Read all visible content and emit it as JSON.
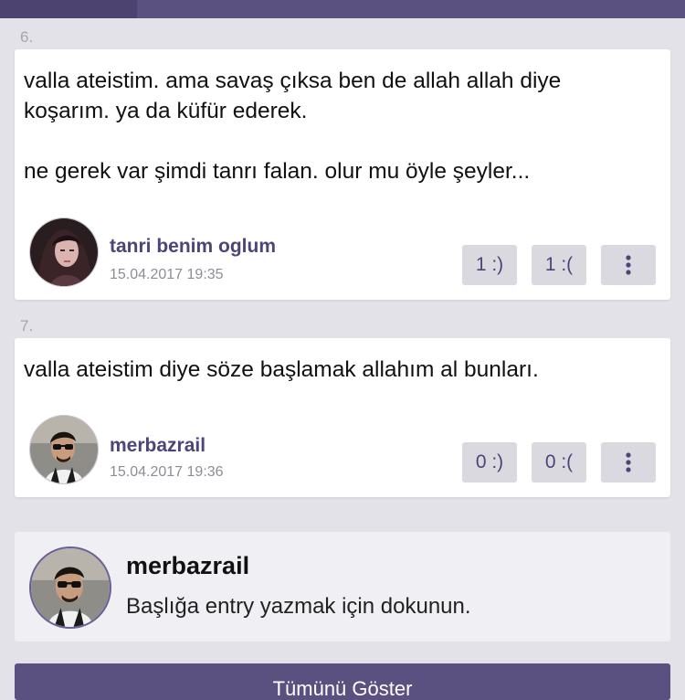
{
  "entries": [
    {
      "number": "6.",
      "text": "valla ateistim. ama savaş çıksa ben de allah allah diye koşarım. ya da küfür ederek.\n\nne gerek var şimdi tanrı falan. olur mu öyle şeyler...",
      "author": "tanri benim oglum",
      "date": "15.04.2017 19:35",
      "upvote": "1 :)",
      "downvote": "1 :(",
      "more_icon": "more-vertical-icon"
    },
    {
      "number": "7.",
      "text": "valla ateistim diye söze başlamak allahım al bunları.",
      "author": "merbazrail",
      "date": "15.04.2017 19:36",
      "upvote": "0 :)",
      "downvote": "0 :(",
      "more_icon": "more-vertical-icon"
    }
  ],
  "compose": {
    "username": "merbazrail",
    "hint": "Başlığa entry yazmak için dokunun."
  },
  "bottom_button": {
    "label": "Tümünü Göster"
  },
  "colors": {
    "accent": "#5b5180",
    "author": "#4d4478",
    "background": "#e3e2e8"
  }
}
